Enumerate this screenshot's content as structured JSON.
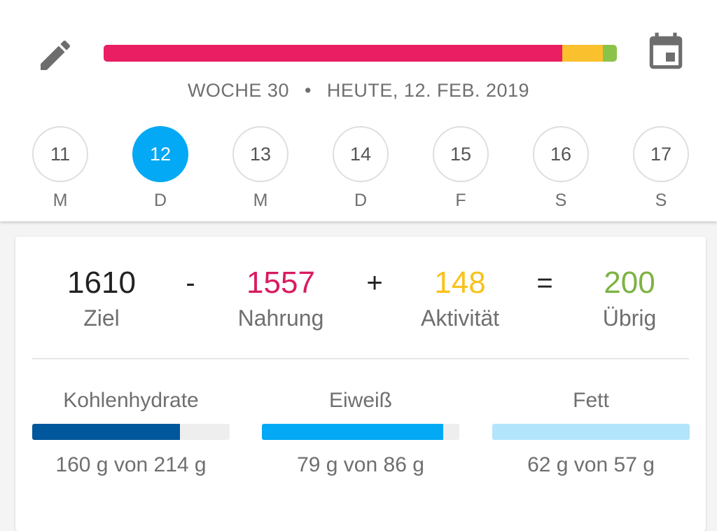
{
  "header": {
    "edit_icon": "pencil-icon",
    "calendar_icon": "calendar-icon",
    "calorie_bar": {
      "segments": [
        {
          "name": "Nahrung",
          "fraction": 0.893,
          "color": "#e91e63"
        },
        {
          "name": "Aktivität",
          "fraction": 0.08,
          "color": "#fbc02d"
        },
        {
          "name": "Übrig",
          "fraction": 0.027,
          "color": "#8bc34a"
        }
      ]
    },
    "week_label": "WOCHE 30",
    "separator": "•",
    "date_label": "HEUTE, 12. FEB. 2019"
  },
  "days": [
    {
      "number": "11",
      "weekday": "M",
      "selected": false
    },
    {
      "number": "12",
      "weekday": "D",
      "selected": true
    },
    {
      "number": "13",
      "weekday": "M",
      "selected": false
    },
    {
      "number": "14",
      "weekday": "D",
      "selected": false
    },
    {
      "number": "15",
      "weekday": "F",
      "selected": false
    },
    {
      "number": "16",
      "weekday": "S",
      "selected": false
    },
    {
      "number": "17",
      "weekday": "S",
      "selected": false
    }
  ],
  "summary": {
    "goal": {
      "value": "1610",
      "label": "Ziel",
      "color": "#222222"
    },
    "minus": "-",
    "food": {
      "value": "1557",
      "label": "Nahrung",
      "color": "#d81b60"
    },
    "plus": "+",
    "activity": {
      "value": "148",
      "label": "Aktivität",
      "color": "#f9c21b"
    },
    "equals": "=",
    "remaining": {
      "value": "200",
      "label": "Übrig",
      "color": "#7cb342"
    }
  },
  "macros": [
    {
      "name": "Kohlenhydrate",
      "amount": "160 g von 214 g",
      "progress": 0.748,
      "color": "#01579b"
    },
    {
      "name": "Eiweiß",
      "amount": "79 g von 86 g",
      "progress": 0.919,
      "color": "#03a9f4"
    },
    {
      "name": "Fett",
      "amount": "62 g von 57 g",
      "progress": 1.0,
      "color": "#b3e5fc"
    }
  ]
}
